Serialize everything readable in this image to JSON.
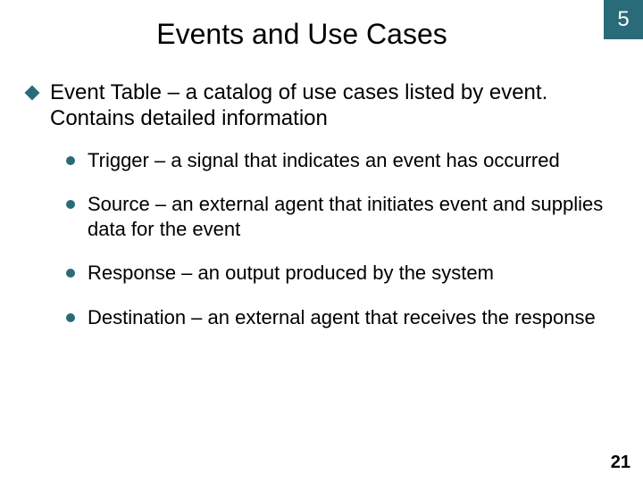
{
  "chapter": "5",
  "title": "Events and Use Cases",
  "main_point": "Event Table – a catalog of use cases listed by event. Contains detailed information",
  "sub_points": [
    "Trigger – a signal that indicates an event has occurred",
    "Source – an external agent that initiates event and supplies data for the event",
    "Response – an output produced by the system",
    "Destination – an external agent that receives the response"
  ],
  "page_number": "21"
}
